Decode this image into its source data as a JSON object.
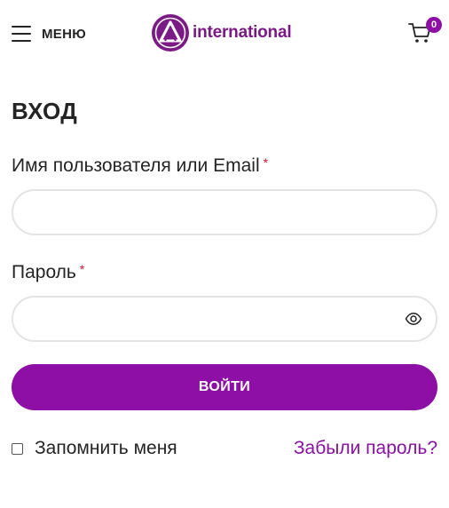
{
  "header": {
    "menu_label": "МЕНЮ",
    "logo_text": "international",
    "cart_count": "0"
  },
  "login": {
    "title": "ВХОД",
    "username_label": "Имя пользователя или Email",
    "username_value": "",
    "password_label": "Пароль",
    "password_value": "",
    "required_mark": "*",
    "submit_label": "ВОЙТИ",
    "remember_label": "Запомнить меня",
    "remember_checked": false,
    "forgot_label": "Забыли пароль?"
  },
  "colors": {
    "accent": "#8d0fa6",
    "logo": "#7b1a86",
    "text": "#242424",
    "required": "#e01020",
    "input_border": "#e4e4e4"
  },
  "icons": {
    "menu": "hamburger-icon",
    "cart": "cart-icon",
    "password_toggle": "eye-icon"
  }
}
